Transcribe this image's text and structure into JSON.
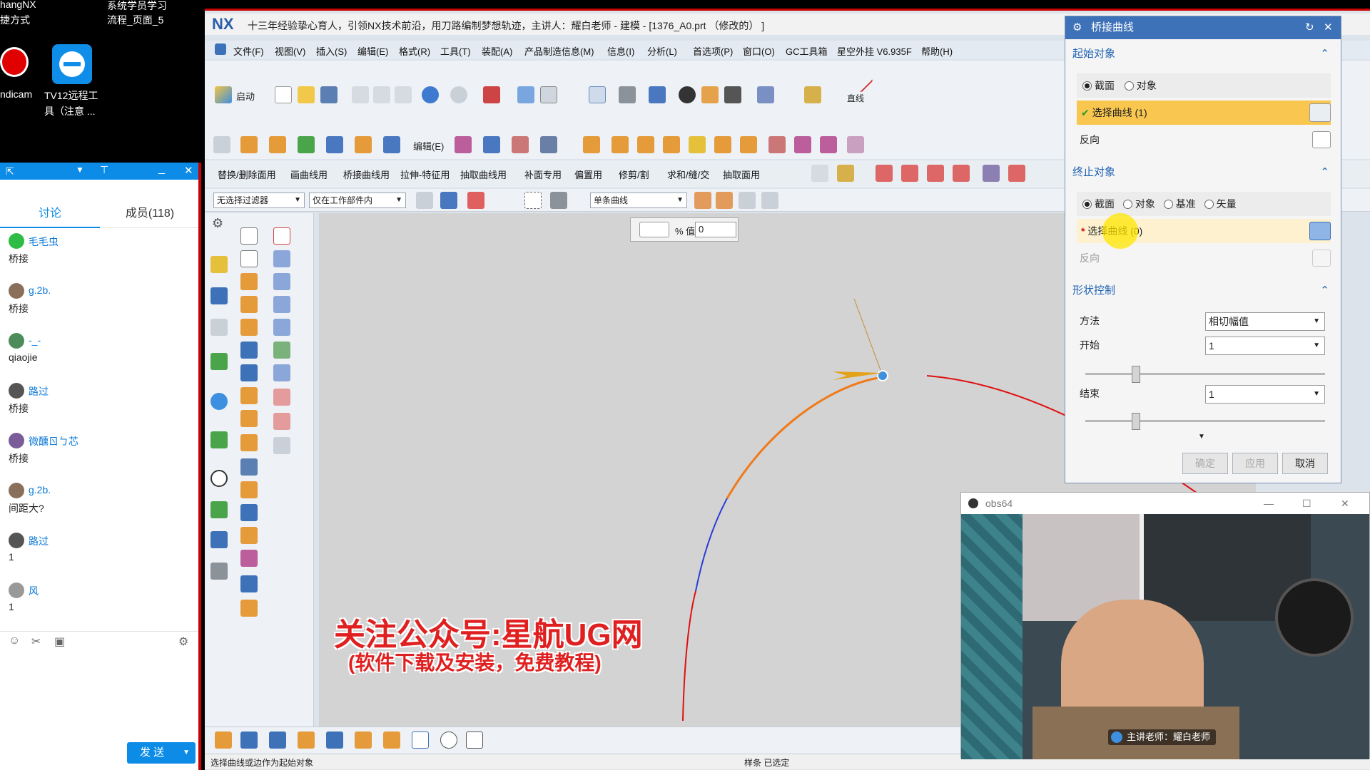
{
  "desktop": {
    "label_nx": "hangNX",
    "label_shortcut": "捷方式",
    "label_sys": "系统学员学习",
    "label_flow": "流程_页面_5",
    "label_bandicam": "ndicam",
    "label_tv": "TV12远程工",
    "label_tv2": "具（注意 ..."
  },
  "chat": {
    "tabs": [
      "讨论",
      "成员(118)"
    ],
    "messages": [
      {
        "name": "毛毛虫",
        "text": "桥接"
      },
      {
        "name": "g.2b.",
        "text": "桥接"
      },
      {
        "name": "-_-",
        "text": "qiaojie"
      },
      {
        "name": "路过",
        "text": "桥接"
      },
      {
        "name": "微醺ㄖㄅ芯",
        "text": "桥接"
      },
      {
        "name": "g.2b.",
        "text": "间距大?"
      },
      {
        "name": "路过",
        "text": "1"
      },
      {
        "name": "风",
        "text": "1"
      }
    ],
    "send_label": "发 送"
  },
  "nx": {
    "logo": "NX",
    "title": "十三年经验挚心育人，引领NX技术前沿，用刀路编制梦想轨迹，主讲人：耀白老师 - 建模 - [1376_A0.prt （修改的） ]",
    "menu": [
      "文件(F)",
      "视图(V)",
      "插入(S)",
      "编辑(E)",
      "格式(R)",
      "工具(T)",
      "装配(A)",
      "产品制造信息(M)",
      "信息(I)",
      "分析(L)",
      "首选项(P)",
      "窗口(O)",
      "GC工具箱",
      "星空外挂 V6.935F",
      "帮助(H)"
    ],
    "start_label": "启动",
    "edit_label": "编辑(E)",
    "line_label": "直线",
    "row3": [
      "替换/删除面用",
      "画曲线用",
      "桥接曲线用",
      "拉伸-特征用",
      "抽取曲线用",
      "补面专用",
      "偏置用",
      "修剪/割",
      "求和/缝/交",
      "抽取面用"
    ],
    "filter": "无选择过滤器",
    "scope": "仅在工作部件内",
    "curve_rule": "单条曲线",
    "status_left": "选择曲线或边作为起始对象",
    "status_mid": "样条 已选定",
    "float_pct": "% 值",
    "float_val": "0"
  },
  "dialog": {
    "title": "桥接曲线",
    "start_section": "起始对象",
    "end_section": "终止对象",
    "shape_section": "形状控制",
    "opt_section": "截面",
    "opt_object": "对象",
    "opt_datum": "基准",
    "opt_vector": "矢量",
    "select_curve_1": "选择曲线 (1)",
    "select_curve_0": "选择曲线 (0)",
    "reverse": "反向",
    "method_label": "方法",
    "method_value": "相切幅值",
    "start_label": "开始",
    "start_value": "1",
    "end_label": "结束",
    "end_value": "1",
    "slider_start": 0.2,
    "slider_end": 0.2,
    "ok": "确定",
    "apply": "应用",
    "cancel": "取消"
  },
  "obs": {
    "title": "obs64",
    "caption": "主讲老师：耀白老师"
  },
  "watermark": {
    "line1": "关注公众号:星航UG网",
    "line2": "(软件下载及安装，免费教程)"
  },
  "colors": {
    "accent": "#3d71b8",
    "highlight": "#f9c74f",
    "curve_red": "#e01010",
    "curve_orange": "#f07a1a",
    "curve_blue": "#2a3dd8"
  }
}
